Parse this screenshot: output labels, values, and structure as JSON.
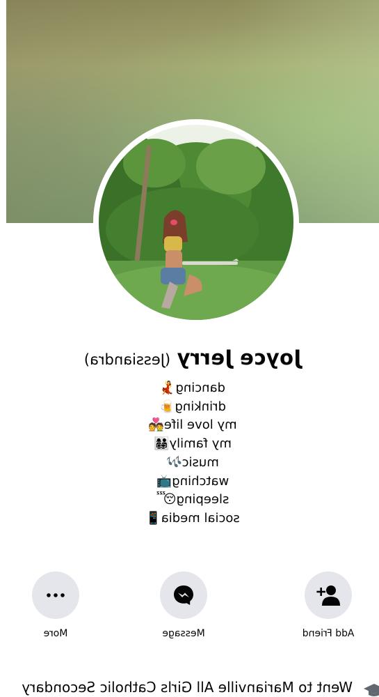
{
  "profile": {
    "name": "Joyce Jerry",
    "alternate_name": "(Jessiandra)",
    "bio_lines": [
      "dancing💃",
      "drinking🍺",
      "my love life💑",
      "my family👨‍👩‍👧‍👦",
      "music🎶",
      "watching📺",
      "sleeping😴",
      "social media📱"
    ]
  },
  "actions": {
    "add_friend": "Add Friend",
    "message": "Message",
    "more": "More"
  },
  "about": {
    "education": "Went to Marianville All Girls Catholic Secondary"
  },
  "icons": {
    "add_friend": "add-friend-icon",
    "message": "messenger-icon",
    "more": "more-dots-icon",
    "education": "graduation-cap-icon"
  },
  "colors": {
    "button_bg": "#e4e6eb",
    "text": "#050505"
  }
}
